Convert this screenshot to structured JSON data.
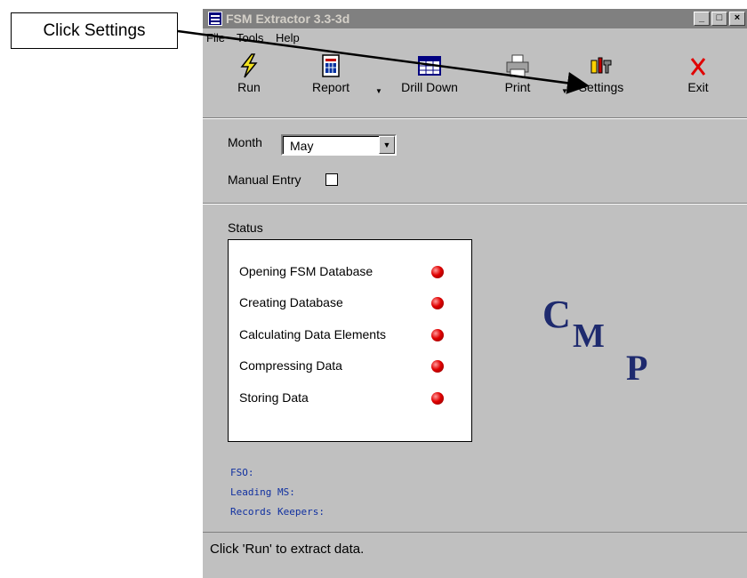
{
  "callout": {
    "text": "Click Settings"
  },
  "window": {
    "title": "FSM Extractor 3.3-3d",
    "controls": {
      "minimize": "_",
      "maximize": "□",
      "close": "×"
    }
  },
  "menu": [
    {
      "label": "File"
    },
    {
      "label": "Tools"
    },
    {
      "label": "Help"
    }
  ],
  "toolbar": [
    {
      "label": "Run",
      "icon": "lightning-icon"
    },
    {
      "label": "Report",
      "icon": "report-icon"
    },
    {
      "label": "Drill Down",
      "icon": "grid-icon"
    },
    {
      "label": "Print",
      "icon": "printer-icon"
    },
    {
      "label": "Settings",
      "icon": "tools-icon"
    },
    {
      "label": "Exit",
      "icon": "red-x-icon"
    }
  ],
  "month": {
    "label": "Month",
    "value": "May"
  },
  "manual_entry": {
    "label": "Manual Entry",
    "checked": false
  },
  "status": {
    "label": "Status",
    "items": [
      {
        "text": "Opening FSM Database",
        "state": "red"
      },
      {
        "text": "Creating Database",
        "state": "red"
      },
      {
        "text": "Calculating Data Elements",
        "state": "red"
      },
      {
        "text": "Compressing Data",
        "state": "red"
      },
      {
        "text": "Storing Data",
        "state": "red"
      }
    ]
  },
  "logo": {
    "c": "C",
    "m": "M",
    "p": "P"
  },
  "info": {
    "fso": "FSO:",
    "leading_ms": "Leading MS:",
    "records_keepers": "Records Keepers:"
  },
  "statusbar": {
    "text": "Click 'Run' to extract data."
  },
  "colors": {
    "title_bar": "#808080",
    "window_bg": "#c0c0c0",
    "led_red": "#e00000",
    "logo": "#1e2a6e",
    "info_text": "#1030a0"
  }
}
